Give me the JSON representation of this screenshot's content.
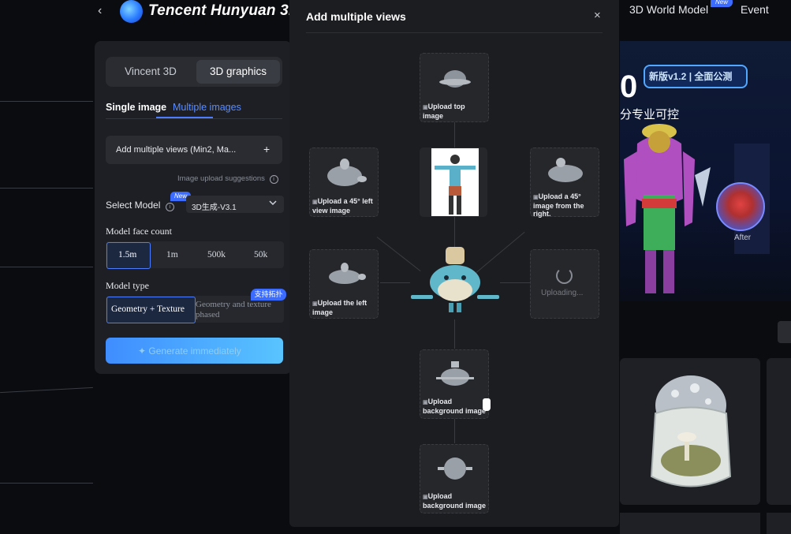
{
  "header": {
    "back_glyph": "‹",
    "brand": "Tencent Hunyuan 3D",
    "nav_world": "3D World Model",
    "nav_world_badge": "New",
    "nav_event": "Event"
  },
  "left_panel": {
    "segments": [
      "Vincent 3D",
      "3D graphics"
    ],
    "subtabs": [
      "Single image",
      "Multiple images"
    ],
    "add_views_label": "Add multiple views (Min2, Ma...",
    "add_views_plus": "+",
    "upload_suggestion": "Image upload suggestions",
    "select_model_label": "Select Model",
    "select_model_badge": "New",
    "select_model_value": "3D生成-V3.1",
    "face_count_label": "Model face count",
    "face_count_options": [
      "1.5m",
      "1m",
      "500k",
      "50k"
    ],
    "model_type_label": "Model type",
    "model_type_options": [
      "Geometry + Texture",
      "Geometry and texture phased"
    ],
    "model_type_badge": "支持拓扑",
    "generate_label": "Generate immediately"
  },
  "banner": {
    "big_text": "0",
    "version_badge": "新版v1.2 | 全面公测",
    "subtitle": "分专业可控",
    "after_label": "After"
  },
  "modal": {
    "title": "Add multiple views",
    "close": "×",
    "slots": {
      "top": "Upload top image",
      "left45": "Upload a 45° left view image",
      "right45": "Upload a 45° image from the right.",
      "left": "Upload the left image",
      "background1": "Upload background image",
      "background2": "Upload background image"
    },
    "uploading": "Uploading..."
  },
  "colors": {
    "accent": "#4c7dff",
    "generate_gradient_start": "#3f8dff",
    "generate_gradient_end": "#58c4ff"
  }
}
